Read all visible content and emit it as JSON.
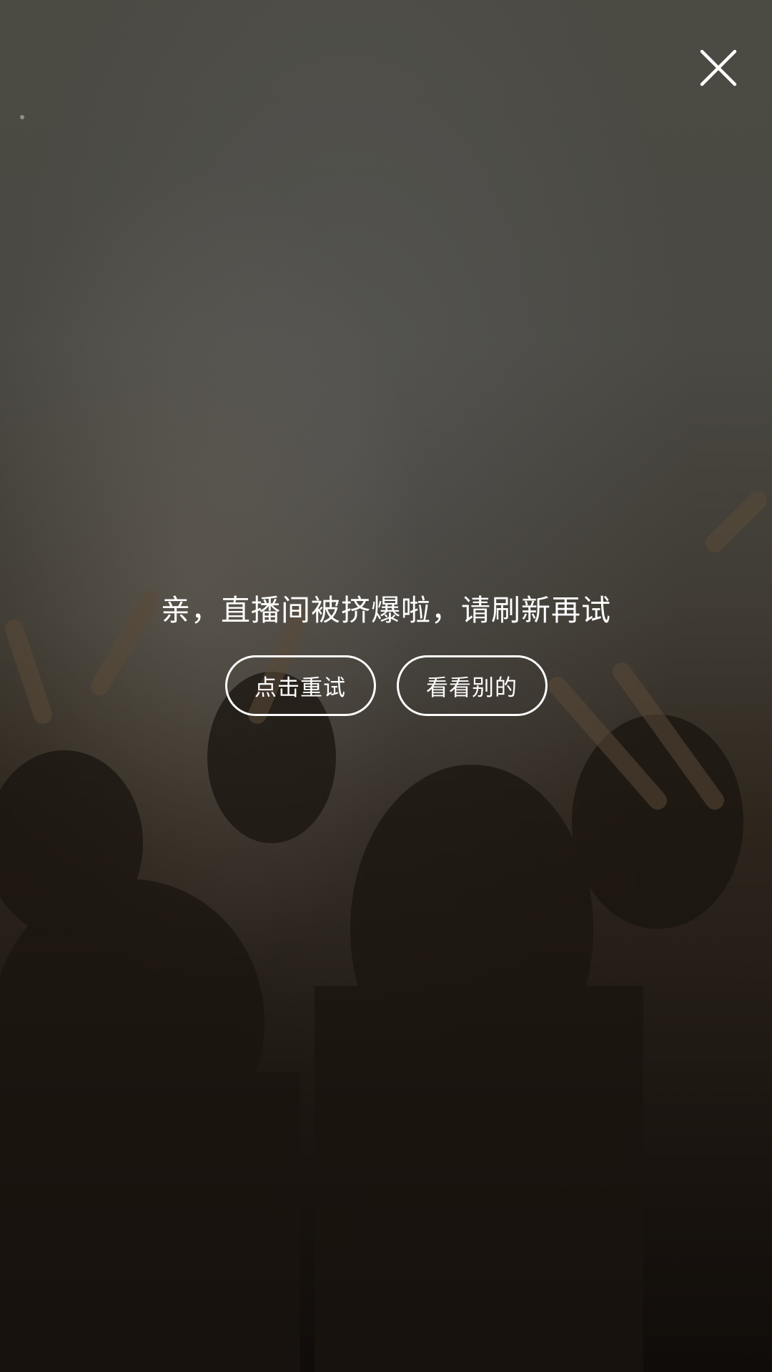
{
  "error": {
    "message": "亲，直播间被挤爆啦，请刷新再试",
    "retry_label": "点击重试",
    "browse_label": "看看别的"
  },
  "icons": {
    "close": "close-icon"
  },
  "colors": {
    "text": "#ffffff",
    "background_top": "#4a4a42",
    "background_bottom": "#120e0b"
  }
}
